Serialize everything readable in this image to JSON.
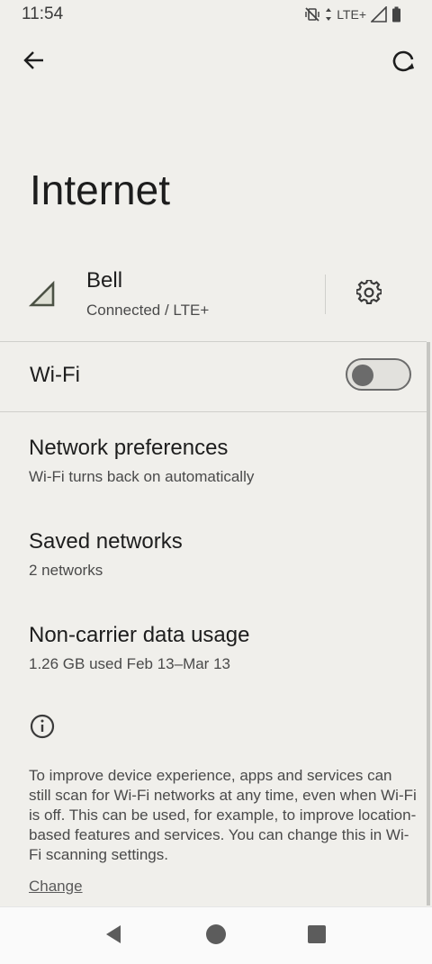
{
  "status_bar": {
    "time": "11:54",
    "network_type": "LTE+",
    "icons": [
      "mute-vibrate-icon",
      "data-arrows-icon",
      "signal-icon",
      "battery-icon"
    ]
  },
  "toolbar": {
    "back_icon": "arrow-back-icon",
    "restart_icon": "internet-reset-icon"
  },
  "page": {
    "title": "Internet"
  },
  "carrier": {
    "name": "Bell",
    "status": "Connected / LTE+",
    "signal_icon": "cell-signal-icon",
    "settings_icon": "gear-icon"
  },
  "wifi": {
    "label": "Wi-Fi",
    "enabled": false
  },
  "preferences": [
    {
      "title": "Network preferences",
      "subtitle": "Wi-Fi turns back on automatically"
    },
    {
      "title": "Saved networks",
      "subtitle": "2 networks"
    },
    {
      "title": "Non-carrier data usage",
      "subtitle": "1.26 GB used Feb 13–Mar 13"
    }
  ],
  "footer": {
    "info_icon": "info-icon",
    "text": "To improve device experience, apps and services can still scan for Wi-Fi networks at any time, even when Wi-Fi is off. This can be used, for example, to improve location-based features and services. You can change this in Wi-Fi scanning settings.",
    "link": "Change"
  },
  "nav_bar": {
    "icons": [
      "nav-back-icon",
      "nav-home-icon",
      "nav-recents-icon"
    ]
  },
  "colors": {
    "background": "#f0efeb",
    "text_primary": "#1d1d1d",
    "text_secondary": "#4a4a4a",
    "divider": "#cfcfcb",
    "toggle_off": "#6b6b6b"
  }
}
